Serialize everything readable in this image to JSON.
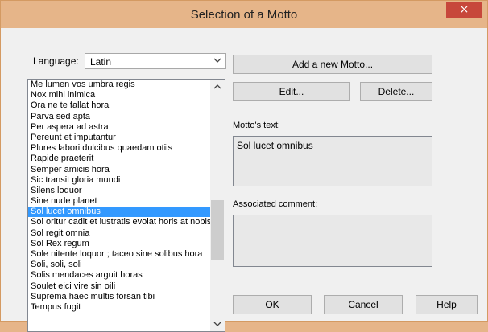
{
  "window": {
    "title": "Selection of a Motto",
    "close_glyph": "×"
  },
  "language": {
    "label": "Language:",
    "selected": "Latin"
  },
  "buttons": {
    "add": "Add a new Motto...",
    "edit": "Edit...",
    "delete": "Delete...",
    "ok": "OK",
    "cancel": "Cancel",
    "help": "Help"
  },
  "motto_text": {
    "label": "Motto's text:",
    "value": "Sol lucet omnibus"
  },
  "comment": {
    "label": "Associated comment:",
    "value": ""
  },
  "mottos": [
    "Me lumen vos umbra regis",
    "Nox mihi inimica",
    "Ora ne te fallat hora",
    "Parva sed apta",
    "Per aspera ad astra",
    "Pereunt et imputantur",
    "Plures labori dulcibus quaedam otiis",
    "Rapide praeterit",
    "Semper amicis hora",
    "Sic transit gloria mundi",
    "Silens loquor",
    "Sine nude planet",
    "Sol lucet omnibus",
    "Sol oritur cadit et lustratis evolat horis at nobis",
    "Sol regit omnia",
    "Sol Rex regum",
    "Sole nitente loquor ; taceo sine solibus hora",
    "Soli, soli, soli",
    "Solis mendaces arguit horas",
    "Soulet eici vire sin oili",
    "Suprema haec multis forsan tibi",
    "Tempus fugit"
  ],
  "selected_motto": "Sol lucet omnibus",
  "colors": {
    "titlebar": "#e6b589",
    "close": "#c7473b",
    "selection": "#3399ff"
  },
  "icons": {
    "close": "close-icon",
    "dropdown": "chevron-down-icon",
    "scroll_up": "chevron-up-icon",
    "scroll_down": "chevron-down-icon"
  }
}
